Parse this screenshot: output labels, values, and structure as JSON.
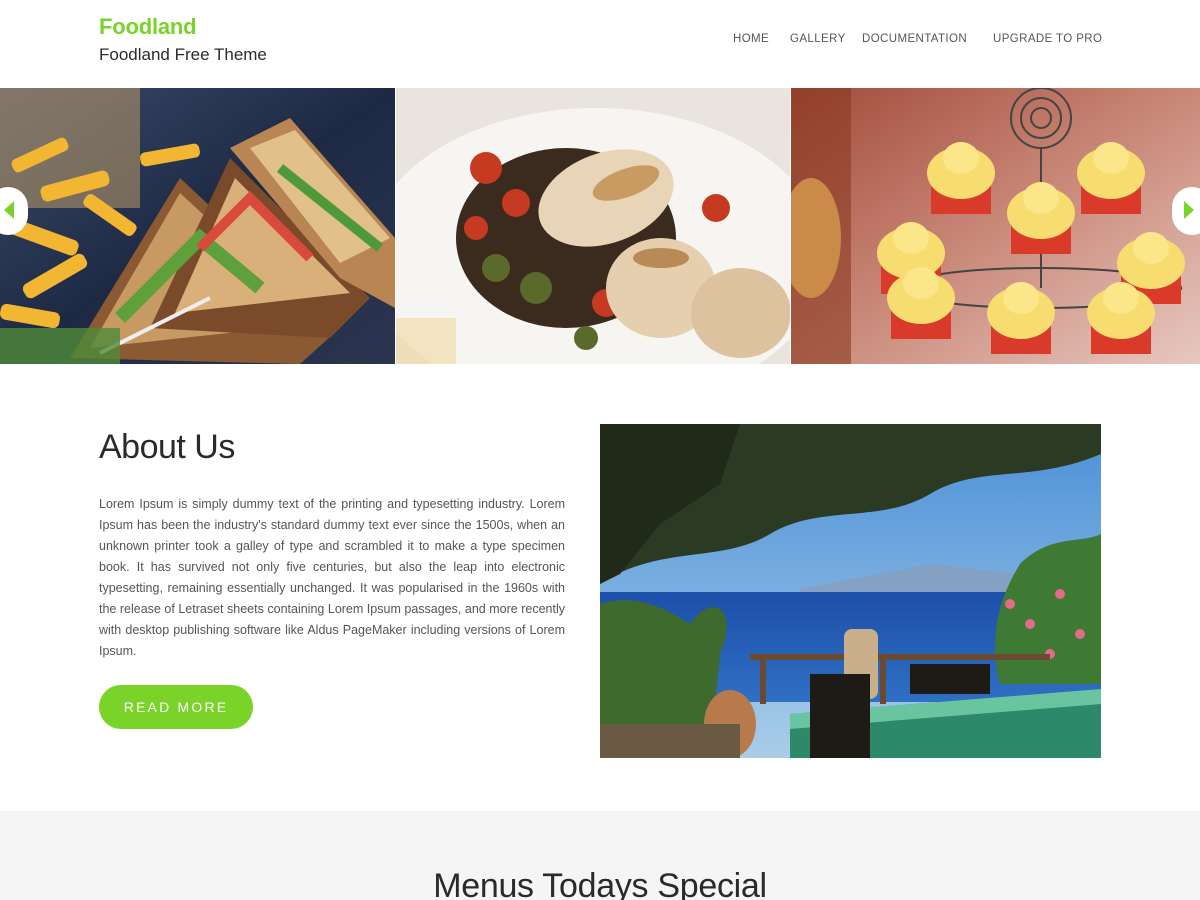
{
  "header": {
    "site_title": "Foodland",
    "tagline": "Foodland Free Theme",
    "brand_color": "#7ad328"
  },
  "nav": {
    "items": [
      {
        "label": "HOME"
      },
      {
        "label": "GALLERY"
      },
      {
        "label": "DOCUMENTATION"
      },
      {
        "label": "UPGRADE TO PRO"
      }
    ]
  },
  "slider": {
    "slides": [
      {
        "subject": "club sandwich with fries"
      },
      {
        "subject": "grilled chicken with roasted vegetables"
      },
      {
        "subject": "cupcakes on a tiered stand"
      }
    ],
    "prev_icon": "chevron-left-icon",
    "next_icon": "chevron-right-icon",
    "arrow_color": "#7ad328"
  },
  "about": {
    "heading": "About Us",
    "body": "Lorem Ipsum is simply dummy text of the printing and typesetting industry. Lorem Ipsum has been the industry's standard dummy text ever since the 1500s, when an unknown printer took a galley of type and scrambled it to make a type specimen book. It has survived not only five centuries, but also the leap into electronic typesetting, remaining essentially unchanged. It was popularised in the 1960s with the release of Letraset sheets containing Lorem Ipsum passages, and more recently with desktop publishing software like Aldus PageMaker including versions of Lorem Ipsum.",
    "button_label": "READ MORE",
    "image_subject": "seaside terrace with table and chairs"
  },
  "menus": {
    "heading": "Menus Todays Special"
  }
}
